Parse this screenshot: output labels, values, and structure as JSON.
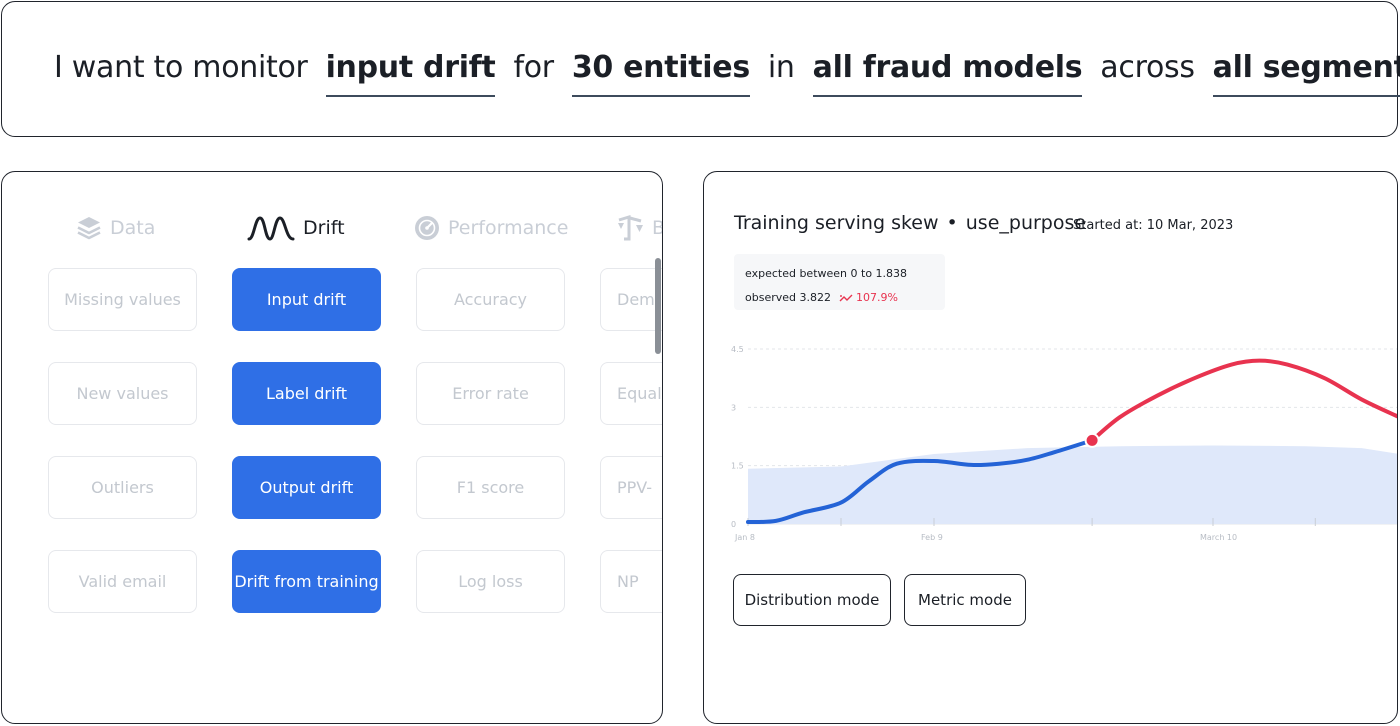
{
  "sentence": {
    "w1": "I want to monitor",
    "s1": "input drift",
    "w2": "for",
    "s2": "30 entities",
    "w3": "in",
    "s3": "all fraud models",
    "w4": "across",
    "s4": "all segments"
  },
  "tabs": [
    {
      "label": "Data",
      "icon": "stack-icon"
    },
    {
      "label": "Drift",
      "icon": "drift-wave-icon"
    },
    {
      "label": "Performance",
      "icon": "gauge-icon"
    },
    {
      "label": "B",
      "icon": "scale-icon"
    }
  ],
  "metrics": {
    "data": [
      "Missing values",
      "New values",
      "Outliers",
      "Valid email"
    ],
    "drift": [
      "Input drift",
      "Label drift",
      "Output drift",
      "Drift from training"
    ],
    "performance": [
      "Accuracy",
      "Error rate",
      "F1 score",
      "Log loss"
    ],
    "bias": [
      "Dem",
      "Equal",
      "PPV-",
      "NP"
    ]
  },
  "chart_panel": {
    "title": "Training serving skew",
    "separator": "•",
    "feature": "use_purpose",
    "started_label": "Started at:",
    "started_value": "10 Mar, 2023",
    "expected_text": "expected between  0 to 1.838",
    "observed_text": "observed  3.822",
    "change_text": "107.9%",
    "buttons": {
      "distribution": "Distribution mode",
      "metric": "Metric mode"
    }
  },
  "colors": {
    "accent": "#2f6fe6",
    "observed_line": "#2463d6",
    "anomaly": "#e8334f",
    "expected_band": "#dfe8fa"
  },
  "chart_data": {
    "type": "line",
    "x_tick_labels": [
      "Jan 8",
      "Feb 9",
      "March 10"
    ],
    "y_tick_labels": [
      "0",
      "1.5",
      "3",
      "4.5"
    ],
    "ylim": [
      0,
      4.5
    ],
    "grid": true,
    "series": [
      {
        "role": "observed-normal",
        "color": "#2463d6",
        "x": [
          0,
          3,
          6,
          10,
          13,
          16,
          20,
          24,
          27,
          30,
          33,
          37
        ],
        "values": [
          0.05,
          0.08,
          0.3,
          0.55,
          1.1,
          1.55,
          1.62,
          1.52,
          1.55,
          1.65,
          1.85,
          2.15
        ]
      },
      {
        "role": "observed-anomaly",
        "color": "#e8334f",
        "x": [
          37,
          40,
          44,
          48,
          52,
          55,
          58,
          62,
          66,
          70
        ],
        "values": [
          2.15,
          2.75,
          3.3,
          3.75,
          4.1,
          4.2,
          4.1,
          3.75,
          3.2,
          2.75
        ]
      }
    ],
    "expected_band": {
      "x": [
        0,
        10,
        20,
        30,
        40,
        50,
        60,
        66,
        70
      ],
      "upper": [
        1.42,
        1.48,
        1.8,
        1.95,
        2.0,
        2.02,
        2.0,
        1.95,
        1.8
      ],
      "lower": [
        0,
        0,
        0,
        0,
        0,
        0,
        0,
        0,
        0
      ]
    },
    "anomaly_start": {
      "x": 37,
      "y": 2.15
    },
    "x_range": [
      0,
      70
    ],
    "x_ticks": [
      {
        "x": 0,
        "label": "Jan 8"
      },
      {
        "x": 10,
        "label": ""
      },
      {
        "x": 20,
        "label": "Feb 9"
      },
      {
        "x": 37,
        "label": ""
      },
      {
        "x": 50,
        "label": "March 10"
      },
      {
        "x": 61,
        "label": ""
      }
    ]
  }
}
